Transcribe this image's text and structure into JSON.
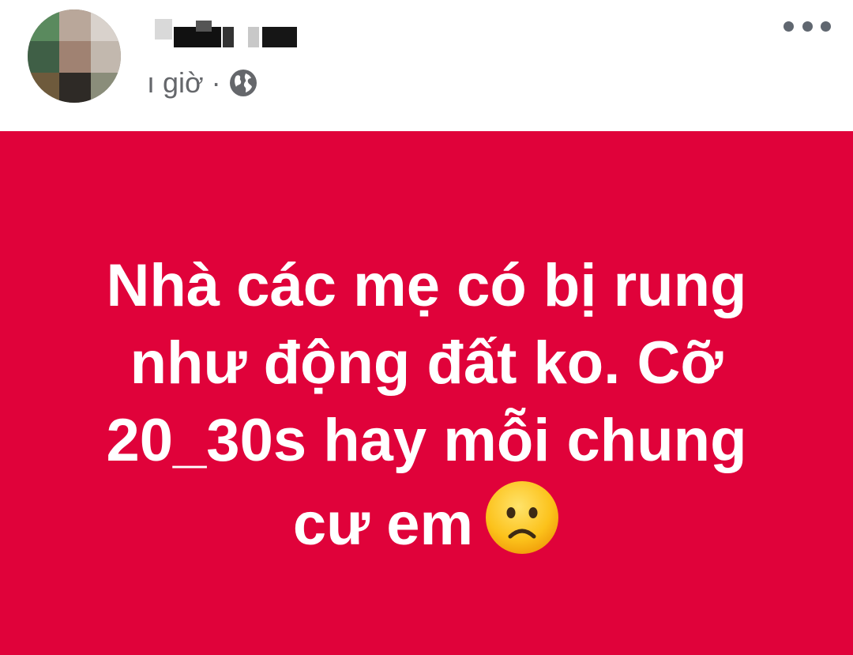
{
  "header": {
    "time_text": "ı giờ",
    "separator": "·",
    "privacy_icon": "globe-icon",
    "more_icon": "more-horizontal-icon"
  },
  "post": {
    "background_color": "#e0023a",
    "text_color": "#ffffff",
    "lines": [
      "Nhà các mẹ có bị rung",
      "như động đất ko. Cỡ",
      "20_30s hay mỗi chung",
      "cư em"
    ],
    "emoji": "slightly-frowning-face"
  }
}
